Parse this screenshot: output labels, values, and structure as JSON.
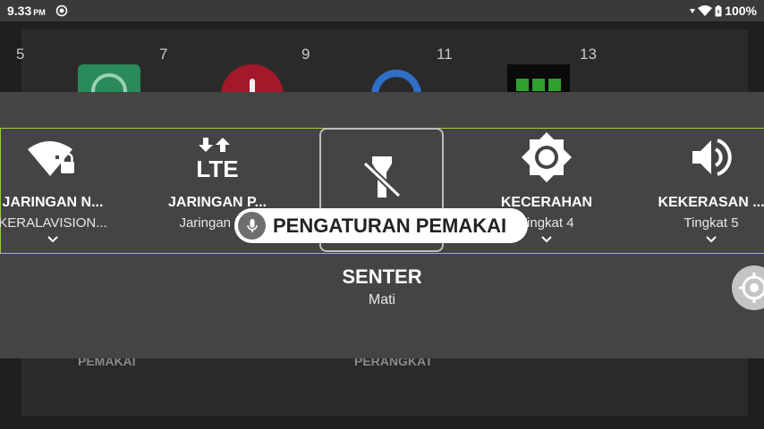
{
  "status_bar": {
    "time": "9.33",
    "ampm": "PM",
    "battery": "100%"
  },
  "background": {
    "page_numbers": [
      "5",
      "7",
      "9",
      "11",
      "13"
    ],
    "labels": [
      "PEMAKAI",
      "PERANGKAT"
    ]
  },
  "tiles": [
    {
      "title": "JARINGAN N...",
      "subtitle": "KERALAVISION...",
      "icon": "wifi-lock-icon"
    },
    {
      "title": "JARINGAN P...",
      "subtitle": "Jaringan N...",
      "icon": "lte-icon"
    },
    {
      "title": "",
      "subtitle": "",
      "icon": "flashlight-off-icon"
    },
    {
      "title": "KECERAHAN",
      "subtitle": "Tingkat 4",
      "icon": "brightness-icon"
    },
    {
      "title": "KEKERASAN ...",
      "subtitle": "Tingkat 5",
      "icon": "volume-icon"
    }
  ],
  "focused_tile": {
    "title": "SENTER",
    "subtitle": "Mati"
  },
  "voice_chip": {
    "text": "PENGATURAN PEMAKAI"
  },
  "colors": {
    "panel": "#444444",
    "focus_border": "#9acd32",
    "status_bar": "#3a3a3a"
  }
}
